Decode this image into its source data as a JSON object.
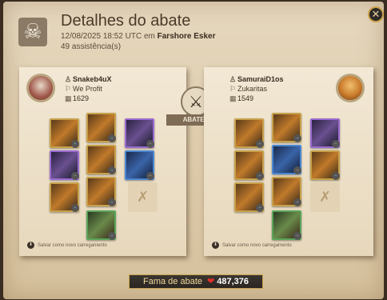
{
  "header": {
    "title": "Detalhes do abate",
    "datetime": "12/08/2025 18:52 UTC em",
    "location": "Farshore Esker",
    "assists": "49 assistência(s)"
  },
  "vs_badge": "ABATEU",
  "killer": {
    "name": "Snakeb4uX",
    "guild": "We Profit",
    "item_power": "1629",
    "save_loadout": "Salvar como novo carregamento"
  },
  "victim": {
    "name": "SamuraiD1os",
    "guild": "Zukaritas",
    "item_power": "1549",
    "save_loadout": "Salvar como novo carregamento"
  },
  "footer": {
    "fame_label": "Fama de abate",
    "fame_value": "487,376"
  },
  "colors": {
    "gold_border": "#c9a14a",
    "parchment": "#e6d8bf",
    "fame_heart": "#e0302a"
  },
  "icons": [
    "skull-icon",
    "close-icon",
    "crossed-swords-icon",
    "helmet-icon",
    "guild-icon",
    "item-power-icon",
    "save-icon",
    "empty-slot-icon",
    "heart-icon"
  ]
}
